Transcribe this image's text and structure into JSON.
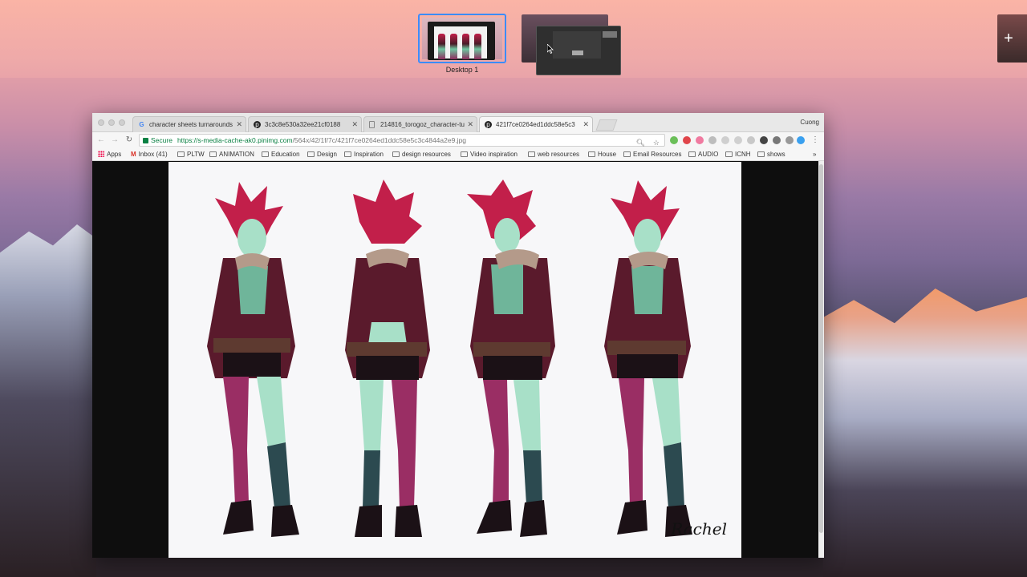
{
  "mission_control": {
    "desktop_label": "Desktop 1",
    "add_space_symbol": "+"
  },
  "browser": {
    "profile_name": "Cuong",
    "tabs": [
      {
        "title": "character sheets turnarounds",
        "favicon": "google-icon",
        "active": false
      },
      {
        "title": "3c3c8e530a32ee21cf0188",
        "favicon": "pinterest-icon",
        "active": false
      },
      {
        "title": "214816_torogoz_character-tu",
        "favicon": "document-icon",
        "active": false
      },
      {
        "title": "421f7ce0264ed1ddc58e5c3",
        "favicon": "pinterest-icon",
        "active": true
      }
    ],
    "omnibox": {
      "secure_label": "Secure",
      "url_scheme_host": "https://s-media-cache-ak0.pinimg.com",
      "url_path": "/564x/42/1f/7c/421f7ce0264ed1ddc58e5c3c4844a2e9.jpg"
    },
    "bookmarks": [
      {
        "label": "Apps",
        "kind": "apps"
      },
      {
        "label": "Inbox (41)",
        "kind": "gmail"
      },
      {
        "label": "PLTW",
        "kind": "folder"
      },
      {
        "label": "ANIMATION",
        "kind": "folder"
      },
      {
        "label": "Education",
        "kind": "folder"
      },
      {
        "label": "Design",
        "kind": "folder"
      },
      {
        "label": "Inspiration",
        "kind": "folder"
      },
      {
        "label": "design resources",
        "kind": "folder"
      },
      {
        "label": "Video inspiration",
        "kind": "folder"
      },
      {
        "label": "web resources",
        "kind": "folder"
      },
      {
        "label": "House",
        "kind": "folder"
      },
      {
        "label": "Email Resources",
        "kind": "folder"
      },
      {
        "label": "AUDIO",
        "kind": "folder"
      },
      {
        "label": "ICNH",
        "kind": "folder"
      },
      {
        "label": "shows",
        "kind": "folder"
      }
    ],
    "bookmarks_overflow": "»"
  },
  "artwork": {
    "signature": "Rachel"
  },
  "colors": {
    "accent_blue": "#3b8cff",
    "secure_green": "#0b8043",
    "hair_red": "#c21f4a",
    "jacket_maroon": "#5a1a2c",
    "skin_mint": "#a8e0c8",
    "stocking_magenta": "#9a2e64"
  }
}
